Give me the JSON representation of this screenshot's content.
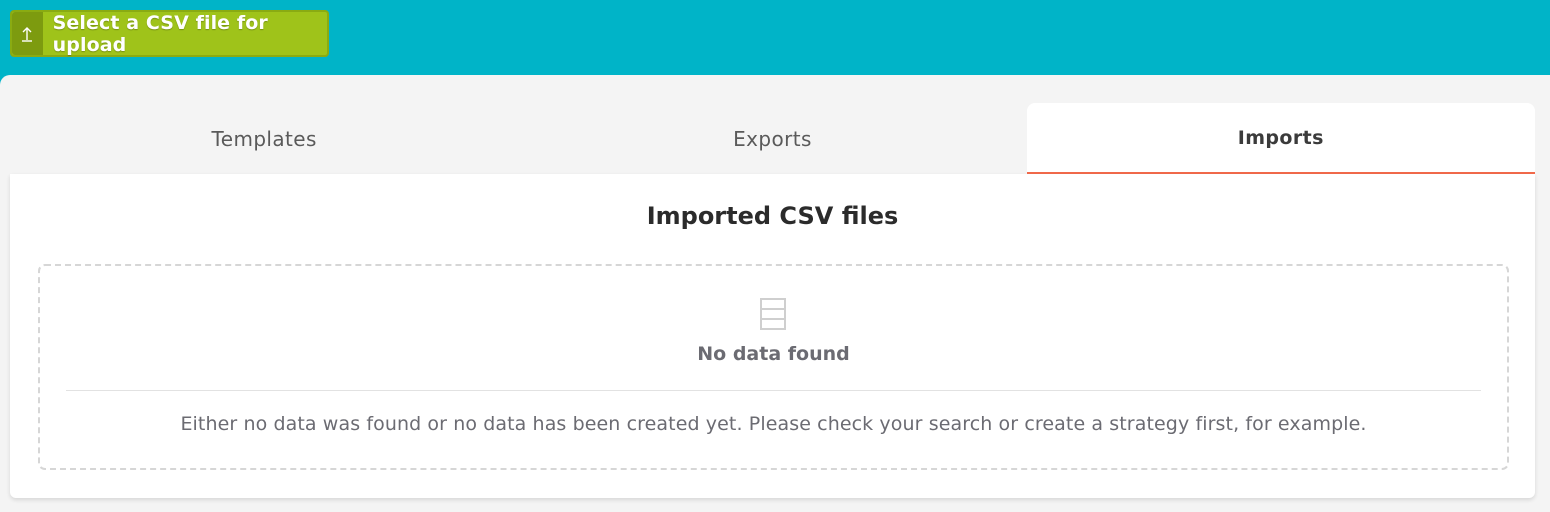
{
  "toolbar": {
    "upload_label": "Select a CSV file for upload",
    "upload_icon": "upload-arrow-icon"
  },
  "tabs": [
    {
      "label": "Templates",
      "active": false
    },
    {
      "label": "Exports",
      "active": false
    },
    {
      "label": "Imports",
      "active": true
    }
  ],
  "panel": {
    "title": "Imported CSV files",
    "empty_state": {
      "icon": "table-icon",
      "title": "No data found",
      "message": "Either no data was found or no data has been created yet. Please check your search or create a strategy first, for example."
    }
  },
  "colors": {
    "header_bg": "#00b4c8",
    "upload_button": "#9fc31a",
    "active_tab_accent": "#f26a4b"
  }
}
